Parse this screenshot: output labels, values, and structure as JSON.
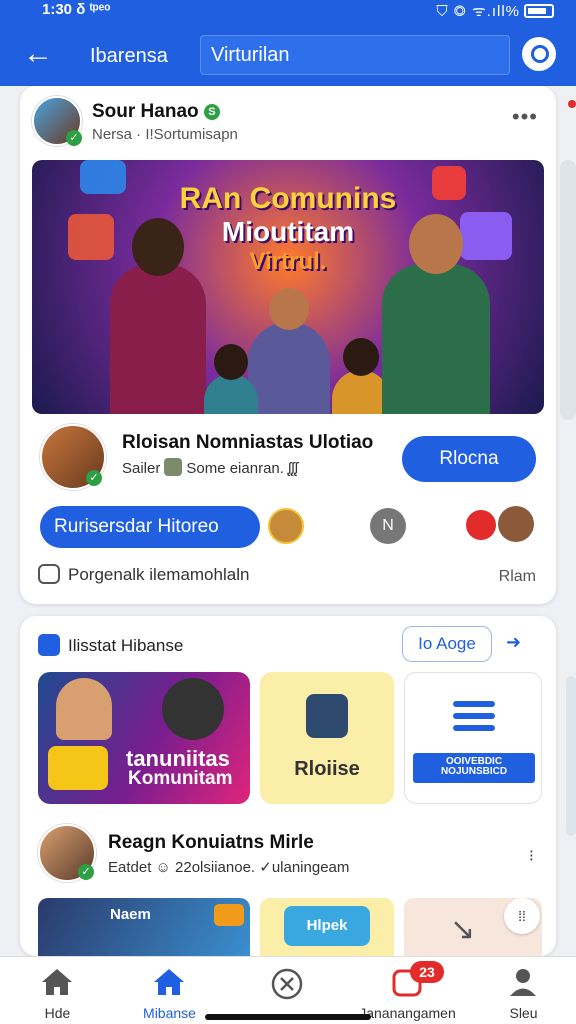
{
  "status_bar": {
    "time": "1:30",
    "extra": "δ ᵗᵖᵉᵒ",
    "signal": "⛉ ◎ ᯤ.ıll%"
  },
  "header": {
    "title": "Ibarensa",
    "search_value": "Virturilan"
  },
  "post1": {
    "author": "Sour Hanao",
    "meta": "Nersa · I!Sortumisapn",
    "banner": {
      "line1": "RAn Comunins",
      "line2": "Mioutitam",
      "line3": "Virtrul."
    },
    "host_name": "Rloisan Nomniastas Ulotiao",
    "host_meta_a": "Sailer",
    "host_meta_b": "Some eianran.",
    "host_meta_c": "ᶘᶘᶘ",
    "join_label": "Rlocna",
    "pill_label": "Rurisersdar Hitoreo",
    "mini_badge": "N",
    "comment_text": "Porgenalk ilemamohlaln",
    "comment_right": "Rlam"
  },
  "section2": {
    "title": "Ilisstat Hibanse",
    "action_label": "Io Aoge",
    "arrow_label": "➜",
    "tiles": {
      "tile1_line1": "tanuniitas",
      "tile1_line2": "Komunitam",
      "tile2_label": "Rloiise",
      "tile3_badge_line1": "OOIVEBDIC",
      "tile3_badge_line2": "NOJUNSBICD"
    }
  },
  "post2": {
    "author": "Reagn Konuiatns Mirle",
    "meta": "Eatdet ☺ 22olsiianoe. ✓ulaningeam",
    "tile_a": "Naem",
    "tile_b": "Hlpek"
  },
  "bottom_nav": [
    {
      "label": "Hde"
    },
    {
      "label": "Mibanse"
    },
    {
      "label": ""
    },
    {
      "label": "Jananangamen",
      "badge": "23"
    },
    {
      "label": "Sleu"
    }
  ],
  "colors": {
    "primary": "#1f5fe0",
    "badge": "#e22c2c",
    "verify": "#2ea043"
  }
}
